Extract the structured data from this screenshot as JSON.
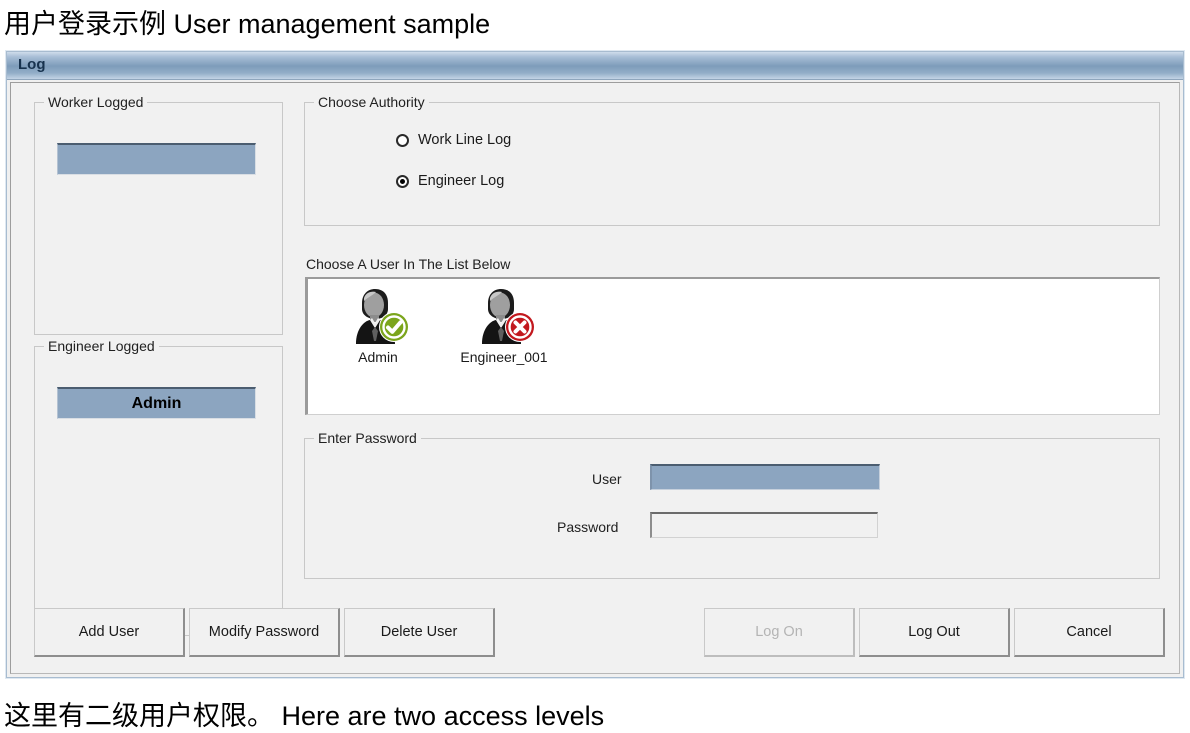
{
  "captions": {
    "top": "用户登录示例  User management sample",
    "bottom": "这里有二级用户权限。  Here are two access levels"
  },
  "window": {
    "title": "Log"
  },
  "groups": {
    "worker_logged": {
      "label": "Worker Logged",
      "selected_item": ""
    },
    "engineer_logged": {
      "label": "Engineer Logged",
      "selected_item": "Admin"
    },
    "choose_authority": {
      "label": "Choose Authority"
    },
    "enter_password": {
      "label": "Enter Password"
    }
  },
  "authority": {
    "options": [
      {
        "label": "Work Line Log",
        "checked": false
      },
      {
        "label": "Engineer Log",
        "checked": true
      }
    ]
  },
  "user_list": {
    "label": "Choose A User In The List Below",
    "items": [
      {
        "name": "Admin",
        "badge": "check-badge-icon",
        "badge_color": "#6d9c18"
      },
      {
        "name": "Engineer_001",
        "badge": "cross-badge-icon",
        "badge_color": "#c2181e"
      }
    ]
  },
  "password_form": {
    "user_label": "User",
    "user_value": "",
    "user_placeholder": "",
    "password_label": "Password",
    "password_value": "",
    "password_placeholder": ""
  },
  "buttons": {
    "add_user": "Add User",
    "modify_password": "Modify Password",
    "delete_user": "Delete User",
    "log_on": "Log On",
    "log_out": "Log Out",
    "cancel": "Cancel"
  },
  "colors": {
    "highlight": "#8ca5c0",
    "titlebar": "#7e9cba",
    "face": "#f1f1f1",
    "check_green": "#6d9c18",
    "cross_red": "#c2181e"
  }
}
